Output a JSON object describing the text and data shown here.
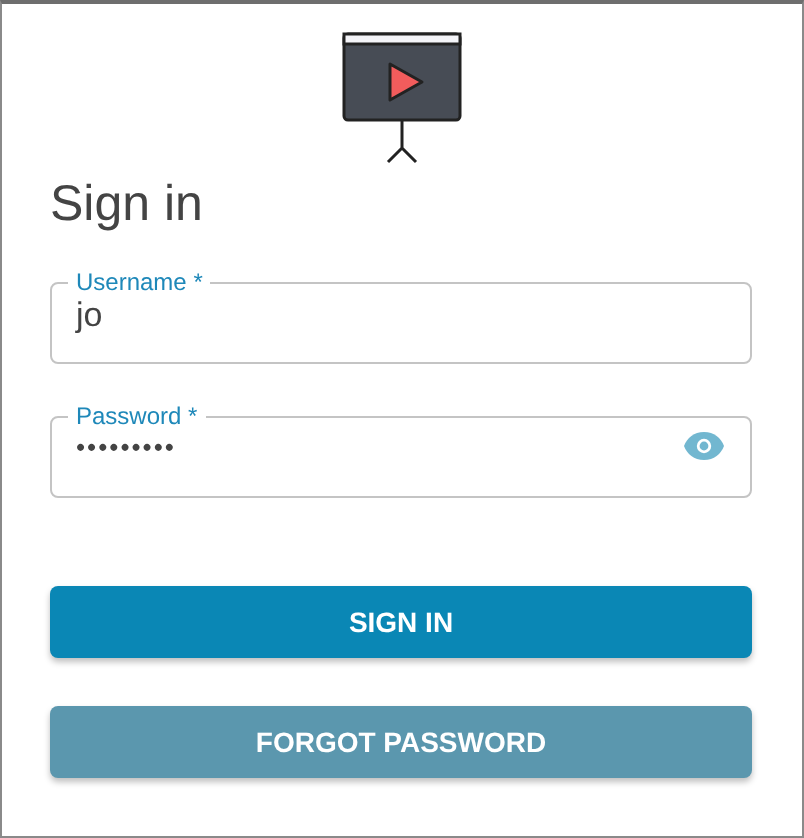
{
  "title": "Sign in",
  "fields": [
    {
      "label": "Username *",
      "value": "jo",
      "kind": "text"
    },
    {
      "label": "Password *",
      "value": "•••••••••",
      "kind": "password"
    }
  ],
  "buttons": [
    {
      "label": "SIGN IN",
      "kind": "primary"
    },
    {
      "label": "FORGOT PASSWORD",
      "kind": "secondary"
    }
  ]
}
